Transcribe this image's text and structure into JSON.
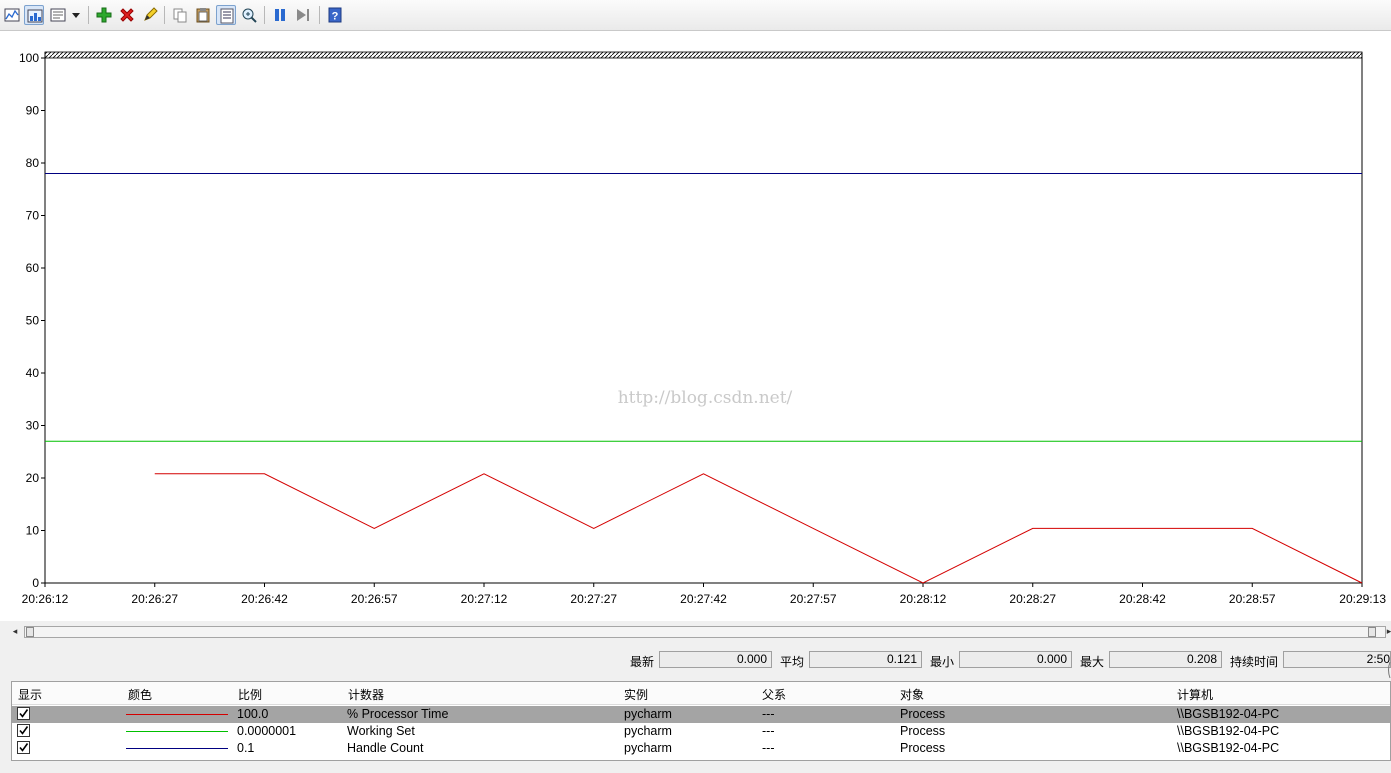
{
  "toolbar": {
    "buttons": [
      {
        "icon": "view-graph-icon"
      },
      {
        "icon": "view-histogram-icon"
      },
      {
        "icon": "view-report-icon"
      },
      {
        "icon": "dropdown-arrow-icon"
      },
      {
        "icon": "add-counter-icon"
      },
      {
        "icon": "delete-counter-icon"
      },
      {
        "icon": "highlight-icon"
      },
      {
        "icon": "copy-properties-icon"
      },
      {
        "icon": "paste-counter-list-icon"
      },
      {
        "icon": "properties-icon"
      },
      {
        "icon": "zoom-icon"
      },
      {
        "icon": "freeze-display-icon"
      },
      {
        "icon": "update-data-icon"
      },
      {
        "icon": "help-icon"
      }
    ]
  },
  "watermark": "http://blog.csdn.net/",
  "chart_data": {
    "type": "line",
    "ylim": [
      0,
      100
    ],
    "y_ticks": [
      "0",
      "10",
      "20",
      "30",
      "40",
      "50",
      "60",
      "70",
      "80",
      "90",
      "100"
    ],
    "x_ticks": [
      "20:26:12",
      "20:26:27",
      "20:26:42",
      "20:26:57",
      "20:27:12",
      "20:27:27",
      "20:27:42",
      "20:27:57",
      "20:28:12",
      "20:28:27",
      "20:28:42",
      "20:28:57",
      "20:29:13"
    ],
    "grid": false,
    "series": [
      {
        "name": "% Processor Time",
        "color": "#d40000",
        "x": [
          "20:26:27",
          "20:26:42",
          "20:26:57",
          "20:27:12",
          "20:27:27",
          "20:27:42",
          "20:27:57",
          "20:28:12",
          "20:28:27",
          "20:28:42",
          "20:28:57",
          "20:29:13"
        ],
        "values": [
          20.8,
          20.8,
          10.4,
          20.8,
          10.4,
          20.8,
          10.4,
          0,
          10.4,
          10.4,
          10.4,
          0
        ]
      },
      {
        "name": "Working Set",
        "color": "#00c000",
        "x": [
          "20:26:12",
          "20:29:13"
        ],
        "values": [
          27,
          27
        ]
      },
      {
        "name": "Handle Count",
        "color": "#000080",
        "x": [
          "20:26:12",
          "20:29:13"
        ],
        "values": [
          78,
          78
        ]
      }
    ]
  },
  "stats": {
    "last_label": "最新",
    "last_value": "0.000",
    "avg_label": "平均",
    "avg_value": "0.121",
    "min_label": "最小",
    "min_value": "0.000",
    "max_label": "最大",
    "max_value": "0.208",
    "duration_label": "持续时间",
    "duration_value": "2:50"
  },
  "legend": {
    "headers": {
      "show": "显示",
      "color": "颜色",
      "scale": "比例",
      "counter": "计数器",
      "instance": "实例",
      "parent": "父系",
      "object": "对象",
      "computer": "计算机"
    },
    "rows": [
      {
        "checked": true,
        "color": "#d40000",
        "scale": "100.0",
        "counter": "% Processor Time",
        "instance": "pycharm",
        "parent": "---",
        "object": "Process",
        "computer": "\\\\BGSB192-04-PC"
      },
      {
        "checked": true,
        "color": "#00c000",
        "scale": "0.0000001",
        "counter": "Working Set",
        "instance": "pycharm",
        "parent": "---",
        "object": "Process",
        "computer": "\\\\BGSB192-04-PC"
      },
      {
        "checked": true,
        "color": "#000080",
        "scale": "0.1",
        "counter": "Handle Count",
        "instance": "pycharm",
        "parent": "---",
        "object": "Process",
        "computer": "\\\\BGSB192-04-PC"
      }
    ]
  }
}
